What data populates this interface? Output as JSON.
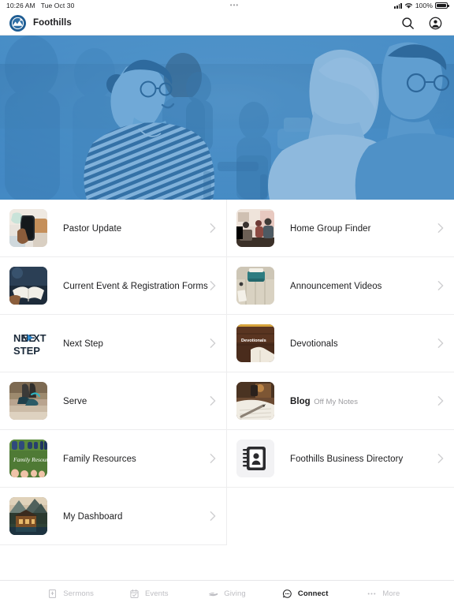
{
  "status_bar": {
    "time": "10:26 AM",
    "date": "Tue Oct 30",
    "center_dots": "•••",
    "battery_percent": "100%",
    "signal_icon": "cellular-signal-icon",
    "wifi_icon": "wifi-icon",
    "battery_icon": "battery-full-icon"
  },
  "navbar": {
    "app_title": "Foothills",
    "logo_icon": "foothills-logo-icon",
    "search_icon": "search-icon",
    "account_icon": "account-circle-icon"
  },
  "hero": {
    "alt": "people-conversing-photo",
    "tint_color": "#3e86c2"
  },
  "tiles": [
    {
      "title": "Pastor Update",
      "subtitle": "",
      "thumb": "phone-in-hand-photo",
      "chevron": "chevron-right-icon"
    },
    {
      "title": "Home Group Finder",
      "subtitle": "",
      "thumb": "living-room-group-photo",
      "chevron": "chevron-right-icon"
    },
    {
      "title": "Current Event & Registration Forms",
      "subtitle": "",
      "thumb": "open-bible-photo",
      "chevron": "chevron-right-icon"
    },
    {
      "title": "Announcement Videos",
      "subtitle": "",
      "thumb": "typewriter-photo",
      "chevron": "chevron-right-icon"
    },
    {
      "title": "Next Step",
      "subtitle": "",
      "thumb": "next-step-logo",
      "chevron": "chevron-right-icon"
    },
    {
      "title": "Devotionals",
      "subtitle": "",
      "thumb": "devotionals-book-photo",
      "chevron": "chevron-right-icon"
    },
    {
      "title": "Serve",
      "subtitle": "",
      "thumb": "hiking-shoes-photo",
      "chevron": "chevron-right-icon"
    },
    {
      "title": "Blog",
      "subtitle": "Off My Notes",
      "thumb": "notebook-pen-photo",
      "chevron": "chevron-right-icon"
    },
    {
      "title": "Family Resources",
      "subtitle": "",
      "thumb": "family-resources-shoes-photo",
      "chevron": "chevron-right-icon"
    },
    {
      "title": "Foothills Business Directory",
      "subtitle": "",
      "thumb": "address-book-icon",
      "chevron": "chevron-right-icon"
    },
    {
      "title": "My Dashboard",
      "subtitle": "",
      "thumb": "mountain-cabin-photo",
      "chevron": "chevron-right-icon"
    }
  ],
  "thumb_labels": {
    "next_step_line1": "NE",
    "next_step_line1b": "XT",
    "next_step_line2": "STEP",
    "devotionals": "Devotionals",
    "family_resources": "Family Resources"
  },
  "tabbar": {
    "items": [
      {
        "label": "Sermons",
        "icon": "bible-icon",
        "active": false
      },
      {
        "label": "Events",
        "icon": "calendar-icon",
        "active": false
      },
      {
        "label": "Giving",
        "icon": "giving-hand-icon",
        "active": false
      },
      {
        "label": "Connect",
        "icon": "chat-bubble-icon",
        "active": true
      },
      {
        "label": "More",
        "icon": "ellipsis-icon",
        "active": false
      }
    ]
  },
  "colors": {
    "brand_blue": "#1f5d93",
    "hero_blue": "#3e86c2",
    "text_primary": "#1c1c1e",
    "text_muted": "#9b9b9f",
    "tab_inactive": "#bdbdc2",
    "divider": "#ededee"
  }
}
